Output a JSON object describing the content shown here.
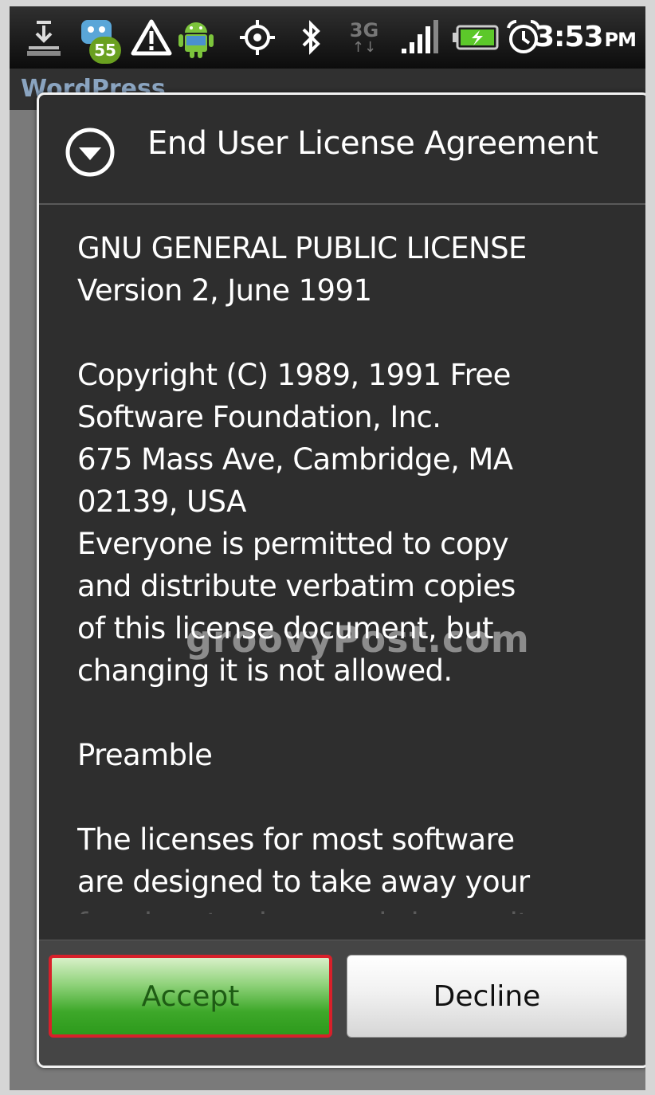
{
  "status_bar": {
    "icons": [
      "download-icon",
      "notification-badge-icon",
      "warning-icon",
      "android-icon",
      "gps-icon",
      "bluetooth-icon",
      "3g-icon",
      "signal-icon",
      "battery-icon",
      "alarm-icon"
    ],
    "badge_count": "55",
    "network_label": "3G",
    "time": "3:53",
    "ampm": "PM"
  },
  "app": {
    "title": "WordPress"
  },
  "dialog": {
    "icon": "chevron-down-circle-icon",
    "title": "End User License Agreement",
    "lines": [
      "GNU GENERAL PUBLIC LICENSE",
      "Version 2, June 1991",
      "",
      "Copyright (C) 1989, 1991 Free",
      "Software Foundation, Inc.",
      "675 Mass Ave, Cambridge, MA",
      "02139, USA",
      "Everyone is permitted to copy",
      "and distribute verbatim copies",
      "of this license document, but",
      "changing it is not allowed.",
      "",
      "Preamble",
      "",
      "The licenses for most software",
      "are designed to take away your",
      "freedom to share and change it"
    ],
    "watermark": "groovyPost.com",
    "accept_label": "Accept",
    "decline_label": "Decline"
  },
  "colors": {
    "accept_border": "#d8202a",
    "accept_green": "#3ea82a",
    "dialog_background": "#2e2e2e"
  }
}
